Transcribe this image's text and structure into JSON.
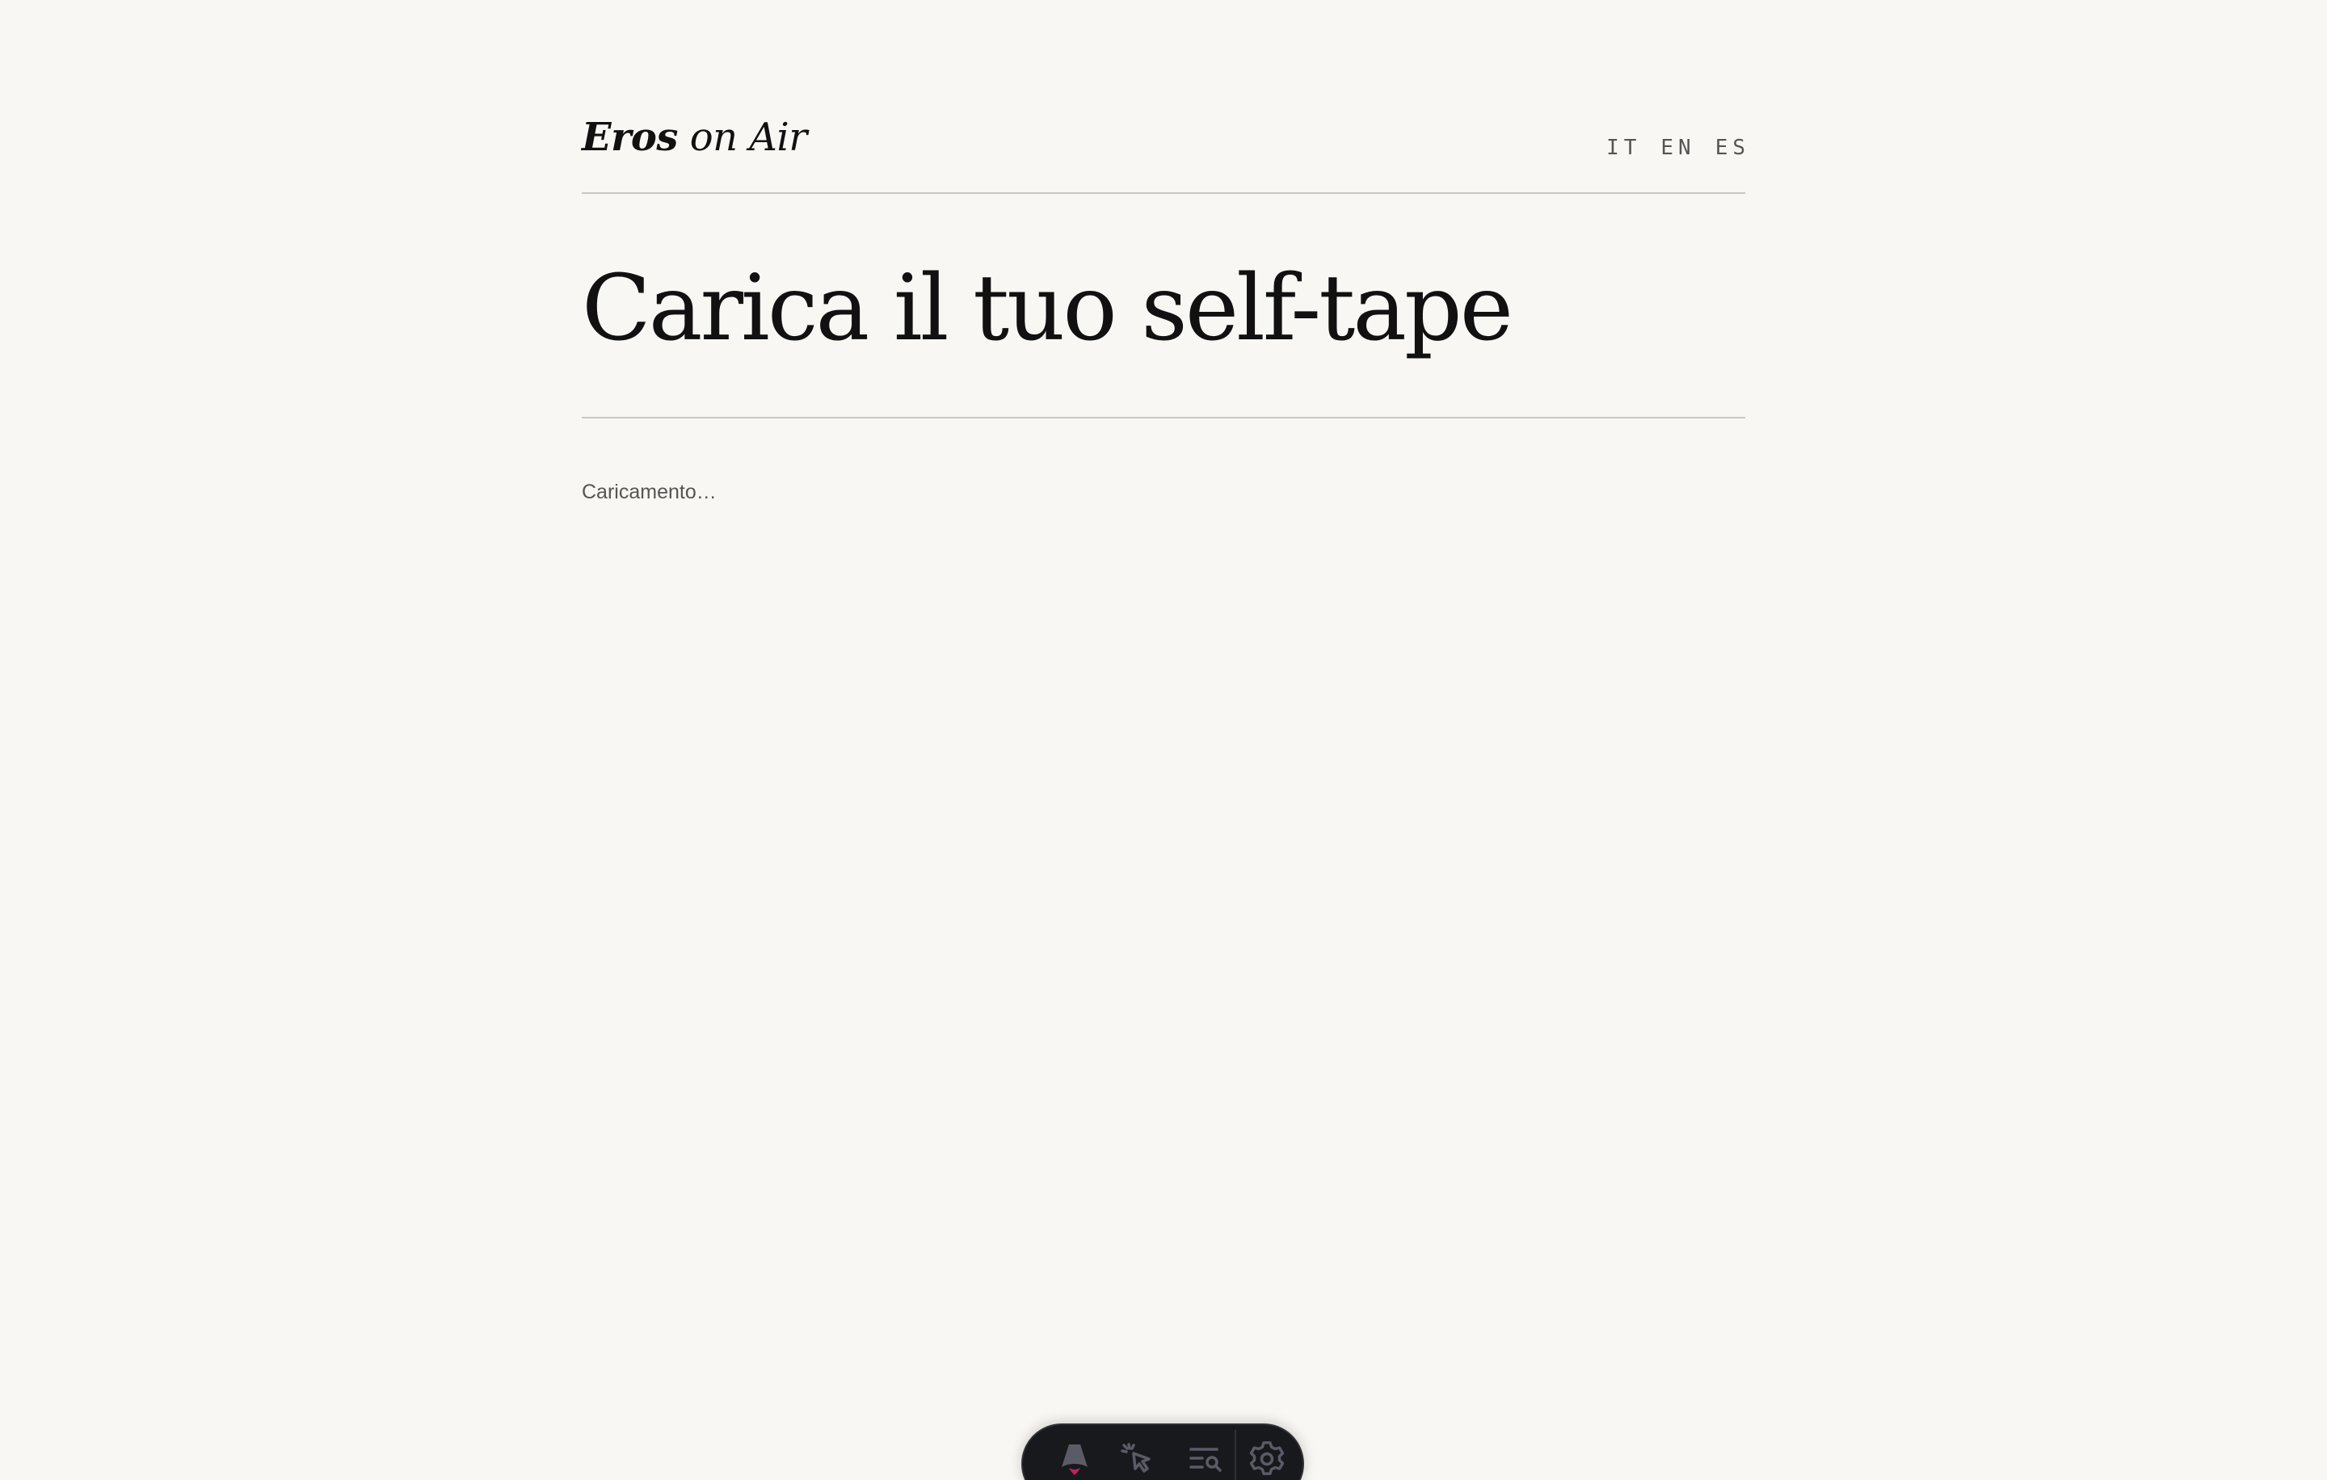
{
  "header": {
    "logo": {
      "strong": "Eros",
      "light": "on Air"
    },
    "languages": [
      "IT",
      "EN",
      "ES"
    ]
  },
  "main": {
    "title": "Carica il tuo self-tape",
    "status": "Caricamento…"
  },
  "devtoolbar": {
    "icons": [
      "astro-logo-icon",
      "inspect-cursor-icon",
      "audit-search-icon",
      "gear-icon"
    ],
    "colors": {
      "background": "#18191c",
      "icon": "#595c66",
      "accent": "#b3265e"
    }
  },
  "colors": {
    "page_background": "#f9f7f3",
    "text": "#111111",
    "muted": "#555555",
    "rule": "#c9c7c3"
  }
}
